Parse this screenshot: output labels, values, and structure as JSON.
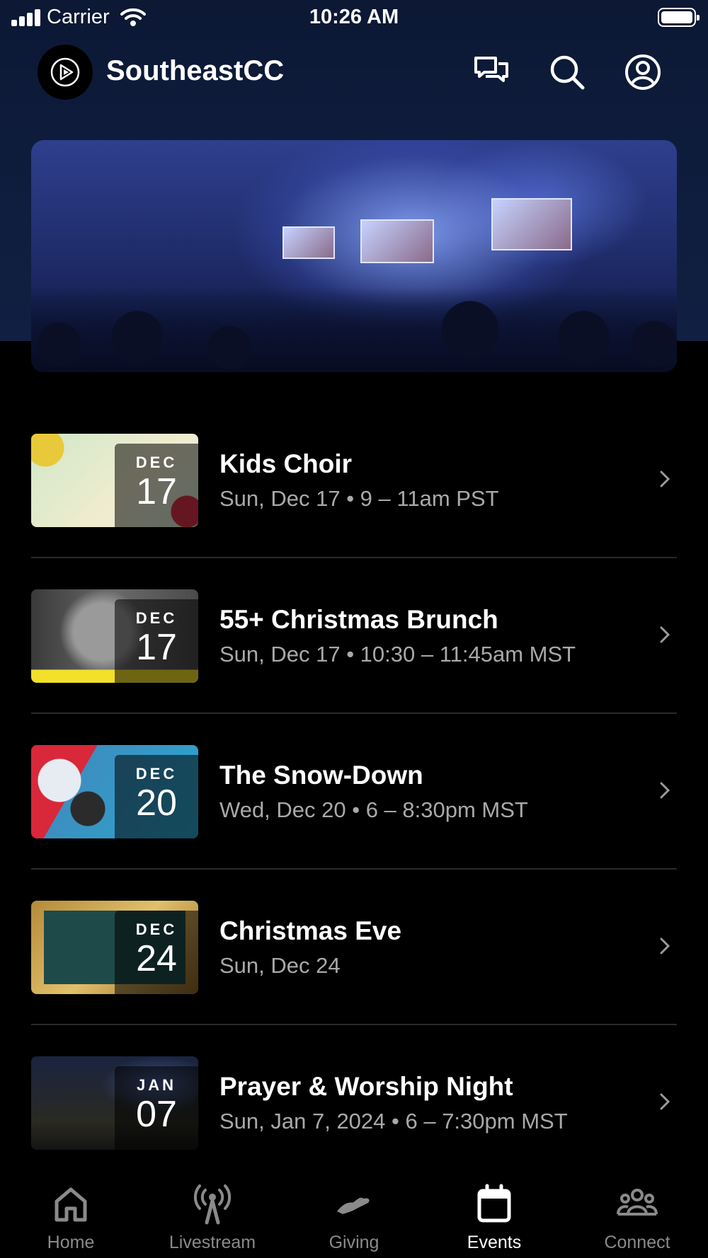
{
  "status_bar": {
    "carrier": "Carrier",
    "time": "10:26 AM"
  },
  "header": {
    "title": "SoutheastCC"
  },
  "events": [
    {
      "title": "Kids Choir",
      "subtitle": "Sun, Dec 17 • 9 – 11am PST",
      "month": "DEC",
      "day": "17"
    },
    {
      "title": "55+ Christmas Brunch",
      "subtitle": "Sun, Dec 17 • 10:30 – 11:45am MST",
      "month": "DEC",
      "day": "17"
    },
    {
      "title": "The Snow-Down",
      "subtitle": "Wed, Dec 20 • 6 – 8:30pm MST",
      "month": "DEC",
      "day": "20"
    },
    {
      "title": "Christmas Eve",
      "subtitle": "Sun, Dec 24",
      "month": "DEC",
      "day": "24"
    },
    {
      "title": "Prayer & Worship Night",
      "subtitle": "Sun, Jan 7, 2024 • 6 – 7:30pm MST",
      "month": "JAN",
      "day": "07"
    }
  ],
  "tabs": [
    {
      "label": "Home",
      "icon": "home-icon"
    },
    {
      "label": "Livestream",
      "icon": "broadcast-icon"
    },
    {
      "label": "Giving",
      "icon": "giving-hand-icon"
    },
    {
      "label": "Events",
      "icon": "calendar-icon",
      "active": true
    },
    {
      "label": "Connect",
      "icon": "people-icon"
    }
  ],
  "colors": {
    "header_bg": "#0f1d3e",
    "background": "#000000",
    "tab_inactive": "#8a8a8a",
    "tab_active": "#ffffff"
  }
}
